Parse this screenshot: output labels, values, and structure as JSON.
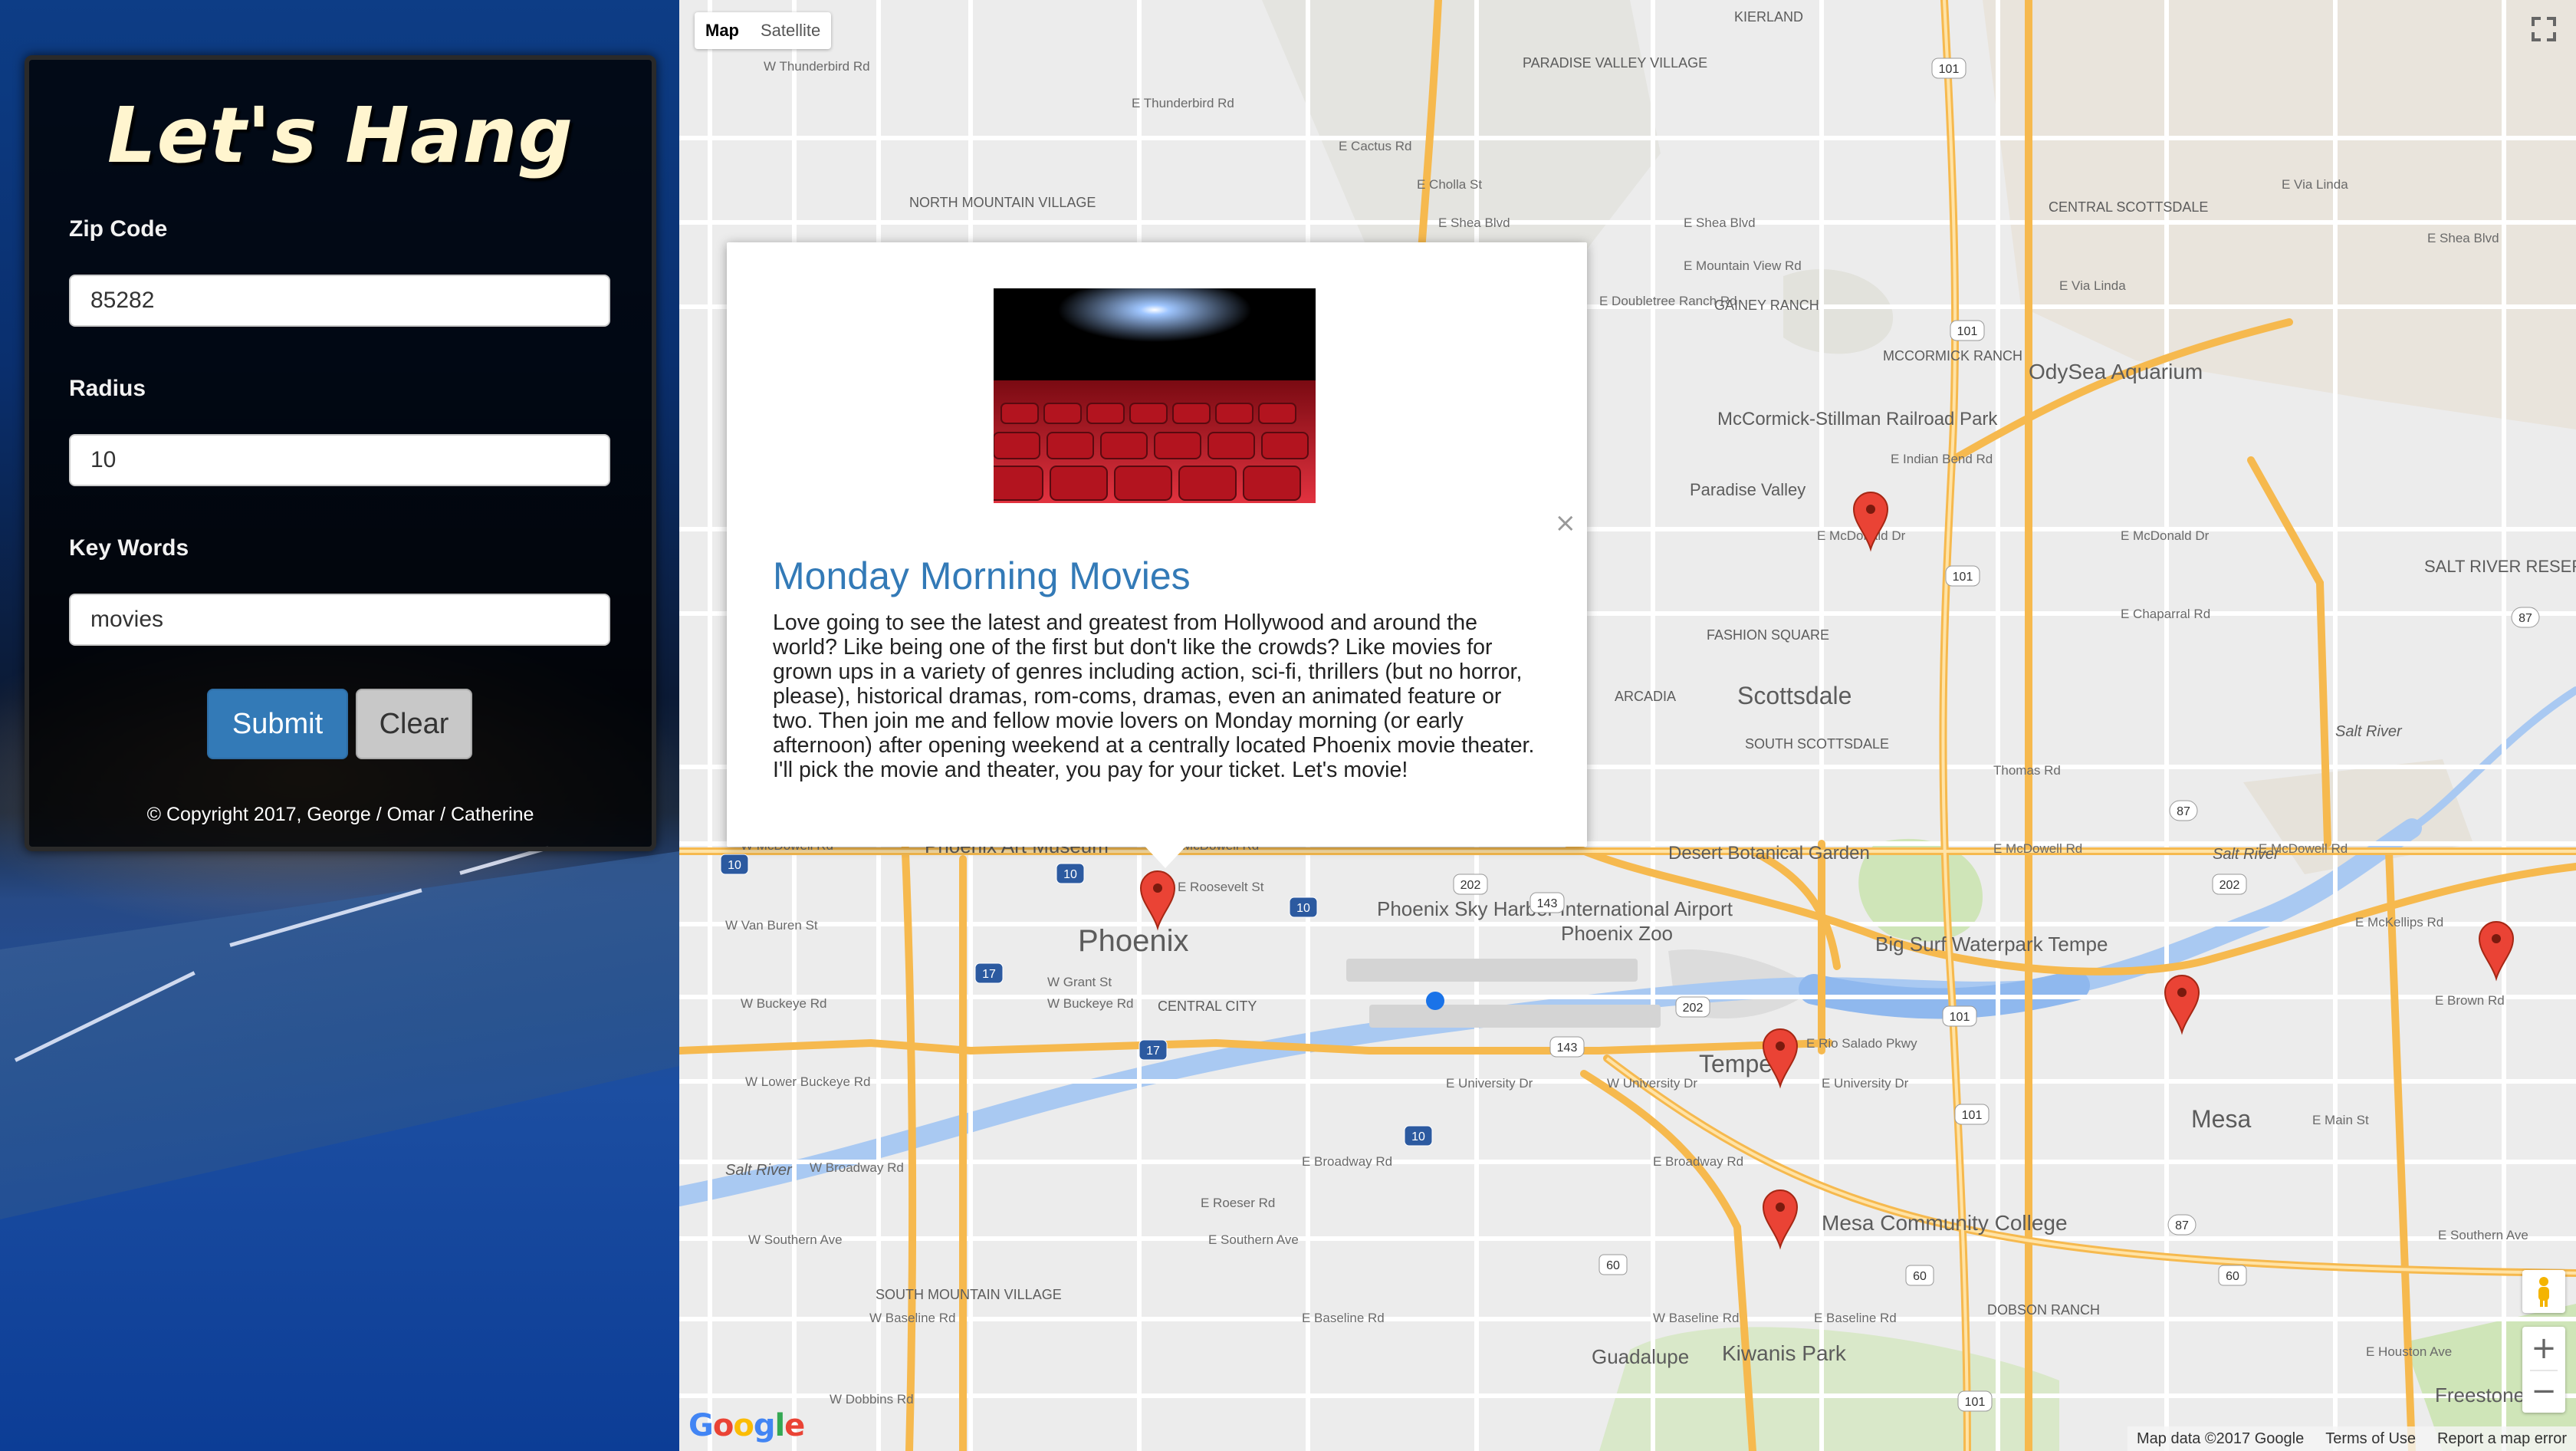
{
  "app": {
    "title": "Let's Hang",
    "copyright": "© Copyright 2017, George / Omar / Catherine"
  },
  "form": {
    "zip_label": "Zip Code",
    "zip_value": "85282",
    "radius_label": "Radius",
    "radius_value": "10",
    "keywords_label": "Key Words",
    "keywords_value": "movies",
    "submit_label": "Submit",
    "clear_label": "Clear",
    "submit_color": "#337ab7"
  },
  "map": {
    "type_buttons": [
      "Map",
      "Satellite"
    ],
    "active_type": "Map",
    "zoom_in": "+",
    "zoom_out": "−",
    "logo": "Google",
    "footer": {
      "data": "Map data ©2017 Google",
      "terms": "Terms of Use",
      "report": "Report a map error"
    },
    "place_labels": {
      "phoenix": "Phoenix",
      "scottsdale": "Scottsdale",
      "tempe": "Tempe",
      "mesa": "Mesa",
      "paradise_valley": "Paradise Valley",
      "sky_harbor": "Phoenix Sky Harbor International Airport",
      "odysea": "OdySea Aquarium",
      "mccormick": "McCormick-Stillman Railroad Park",
      "phoenix_zoo": "Phoenix Zoo",
      "big_surf": "Big Surf Waterpark Tempe",
      "desert_botanical": "Desert Botanical Garden",
      "mesa_cc": "Mesa Community College",
      "kiwanis": "Kiwanis Park",
      "guadalupe": "Guadalupe",
      "phoenix_art": "Phoenix Art Museum",
      "central_city": "CENTRAL CITY",
      "kierland": "KIERLAND",
      "paradise_valley_village": "PARADISE VALLEY VILLAGE",
      "north_mountain": "NORTH MOUNTAIN VILLAGE",
      "gainey": "GAINEY RANCH",
      "mccormick_ranch": "MCCORMICK RANCH",
      "central_scottsdale": "CENTRAL SCOTTSDALE",
      "fashion_square": "FASHION SQUARE",
      "arcadia": "ARCADIA",
      "south_scottsdale": "SOUTH SCOTTSDALE",
      "south_mountain": "SOUTH MOUNTAIN VILLAGE",
      "dobson_ranch": "DOBSON RANCH",
      "salt_river_res": "SALT RIVER RESERVATION",
      "freestone": "Freestone",
      "salt_river_1": "Salt River",
      "salt_river_2": "Salt River",
      "salt_river_3": "Salt River"
    },
    "road_labels": [
      "E Cactus Rd",
      "E Cholla St",
      "E Shea Blvd",
      "E Shea Blvd",
      "E Mountain View Rd",
      "E Doubletree Ranch Rd",
      "E Via Linda",
      "E Indian Bend Rd",
      "E McDonald Dr",
      "E McDonald Dr",
      "E Chaparral Rd",
      "Thomas Rd",
      "E McDowell Rd",
      "E McDowell Rd",
      "E Roosevelt St",
      "W Van Buren St",
      "W Grant St",
      "W Buckeye Rd",
      "W Buckeye Rd",
      "W Lower Buckeye Rd",
      "W Broadway Rd",
      "E Broadway Rd",
      "E Broadway Rd",
      "E Roeser Rd",
      "E Southern Ave",
      "W Southern Ave",
      "W Baseline Rd",
      "E Baseline Rd",
      "W Baseline Rd",
      "E Baseline Rd",
      "W Dobbins Rd",
      "E University Dr",
      "W University Dr",
      "E University Dr",
      "E Rio Salado Pkwy",
      "E McKellips Rd",
      "E Brown Rd",
      "E Main St",
      "E Southern Ave",
      "E Houston Ave",
      "W Thunderbird Rd",
      "E Thunderbird Rd",
      "E Via Linda",
      "E Shea Blvd",
      "W McDowell Rd",
      "E McDowell Rd"
    ],
    "highway_shields": [
      "101",
      "101",
      "101",
      "101",
      "101",
      "101",
      "202",
      "202",
      "202",
      "143",
      "143",
      "10",
      "10",
      "10",
      "10",
      "17",
      "17",
      "60",
      "60",
      "60",
      "87",
      "87",
      "87"
    ]
  },
  "info_window": {
    "title": "Monday Morning Movies",
    "description": "Love going to see the latest and greatest from Hollywood and around the world? Like being one of the first but don't like the crowds? Like movies for grown ups in a variety of genres including action, sci-fi, thrillers (but no horror, please), historical dramas, rom-coms, dramas, even an animated feature or two. Then join me and fellow movie lovers on Monday morning (or early afternoon) after opening weekend at a centrally located Phoenix movie theater. I'll pick the movie and theater, you pay for your ticket. Let's movie!",
    "close_glyph": "×",
    "title_color": "#337ab7"
  },
  "markers": [
    {
      "name": "marker-phoenix"
    },
    {
      "name": "marker-scottsdale"
    },
    {
      "name": "marker-tempe"
    },
    {
      "name": "marker-mesa-cc"
    },
    {
      "name": "marker-mesa"
    },
    {
      "name": "marker-east"
    }
  ]
}
